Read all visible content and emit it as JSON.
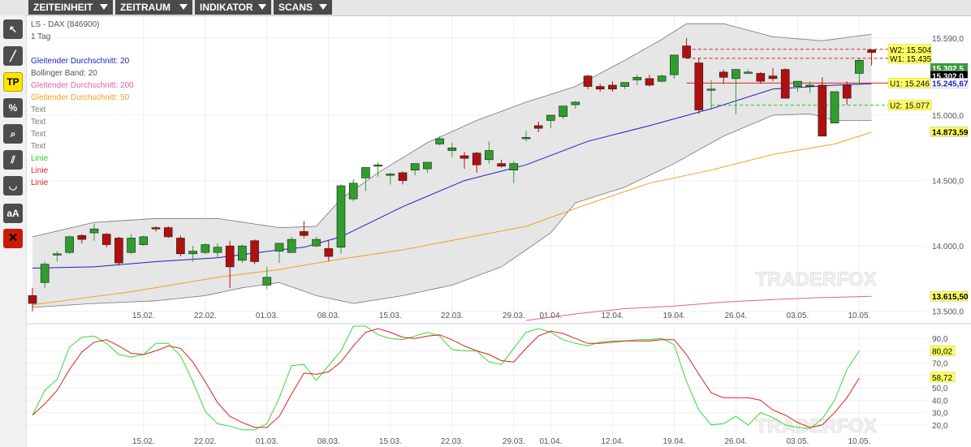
{
  "menu": [
    {
      "label": "ZEITEINHEIT"
    },
    {
      "label": "ZEITRAUM"
    },
    {
      "label": "INDIKATOR"
    },
    {
      "label": "SCANS"
    }
  ],
  "tools": [
    {
      "icon": "cursor-icon",
      "glyph": "↖"
    },
    {
      "icon": "line-draw-icon",
      "glyph": "╱"
    },
    {
      "label": "TP"
    },
    {
      "label": "%"
    },
    {
      "icon": "magnifier-icon",
      "glyph": "⌕"
    },
    {
      "icon": "parallel-lines-icon",
      "glyph": "⫽"
    },
    {
      "icon": "arc-icon",
      "glyph": "◡"
    },
    {
      "label": "aA"
    },
    {
      "icon": "delete-icon",
      "glyph": "✕"
    }
  ],
  "legend": {
    "instrument": "LS - DAX",
    "instrument_id": "(846900)",
    "timeframe": "1 Tag",
    "items": [
      {
        "label": "Gleitender Durchschnitt: 20",
        "color": "#2020c0"
      },
      {
        "label": "Bollinger Band: 20",
        "color": "#555555"
      },
      {
        "label": "Gleitender Durchschnitt: 200",
        "color": "#e060a0"
      },
      {
        "label": "Gleitender Durchschnitt: 50",
        "color": "#f0a020"
      },
      {
        "label": "Text",
        "color": "#777777"
      },
      {
        "label": "Text",
        "color": "#777777"
      },
      {
        "label": "Text",
        "color": "#777777"
      },
      {
        "label": "Text",
        "color": "#777777"
      },
      {
        "label": "Linie",
        "color": "#22cc22"
      },
      {
        "label": "Linie",
        "color": "#dd2222"
      },
      {
        "label": "Linie",
        "color": "#dd2222"
      }
    ]
  },
  "watermark": "TRADERFOX",
  "colors": {
    "up": "#2f9e2f",
    "down": "#b01010",
    "ma20": "#2020c0",
    "ma50": "#f0a020",
    "ma200": "#e060a0",
    "band": "#e2e2e2",
    "k": "#33dd33",
    "d": "#dd2222",
    "wave": "#22bb22"
  },
  "chart_data": [
    {
      "type": "candlestick",
      "title": "LS - DAX (846900)",
      "ylim": [
        13430,
        15720
      ],
      "y_ticks": [
        {
          "v": 15590,
          "label": "15.590,0"
        },
        {
          "v": 15000,
          "label": "15.000,0"
        },
        {
          "v": 14500,
          "label": "14.500,0"
        },
        {
          "v": 14000,
          "label": "14.000,0"
        },
        {
          "v": 13500,
          "label": "13.500,0"
        }
      ],
      "x_ticks": [
        {
          "i": 9,
          "label": "15.02."
        },
        {
          "i": 14,
          "label": "22.02."
        },
        {
          "i": 19,
          "label": "01.03."
        },
        {
          "i": 24,
          "label": "08.03."
        },
        {
          "i": 29,
          "label": "15.03."
        },
        {
          "i": 34,
          "label": "22.03."
        },
        {
          "i": 39,
          "label": "29.03."
        },
        {
          "i": 42,
          "label": "01.04."
        },
        {
          "i": 47,
          "label": "12.04."
        },
        {
          "i": 52,
          "label": "19.04."
        },
        {
          "i": 57,
          "label": "26.04."
        },
        {
          "i": 62,
          "label": "03.05."
        },
        {
          "i": 67,
          "label": "10.05."
        }
      ],
      "candles": [
        [
          13620,
          13680,
          13500,
          13560
        ],
        [
          13720,
          13880,
          13680,
          13860
        ],
        [
          13930,
          13960,
          13880,
          13940
        ],
        [
          13950,
          14080,
          13940,
          14070
        ],
        [
          14080,
          14090,
          14020,
          14050
        ],
        [
          14100,
          14170,
          14040,
          14130
        ],
        [
          14090,
          14100,
          13990,
          14010
        ],
        [
          14060,
          14070,
          13850,
          13870
        ],
        [
          13950,
          14090,
          13940,
          14060
        ],
        [
          14010,
          14080,
          14000,
          14070
        ],
        [
          14140,
          14150,
          14110,
          14130
        ],
        [
          14140,
          14150,
          14060,
          14070
        ],
        [
          14060,
          14080,
          13920,
          13940
        ],
        [
          13940,
          14000,
          13880,
          13960
        ],
        [
          13950,
          14020,
          13940,
          14010
        ],
        [
          13950,
          14020,
          13910,
          13990
        ],
        [
          14000,
          14040,
          13680,
          13840
        ],
        [
          13890,
          14010,
          13870,
          14000
        ],
        [
          14040,
          14050,
          13860,
          13880
        ],
        [
          13700,
          13840,
          13670,
          13760
        ],
        [
          13960,
          14000,
          13870,
          14020
        ],
        [
          13950,
          14070,
          13960,
          14050
        ],
        [
          14110,
          14190,
          14060,
          14080
        ],
        [
          14000,
          14070,
          13990,
          14050
        ],
        [
          13980,
          14040,
          13880,
          13920
        ],
        [
          13990,
          14470,
          13940,
          14460
        ],
        [
          14360,
          14510,
          14340,
          14480
        ],
        [
          14520,
          14560,
          14420,
          14600
        ],
        [
          14610,
          14640,
          14530,
          14620
        ],
        [
          14540,
          14560,
          14470,
          14550
        ],
        [
          14560,
          14570,
          14470,
          14500
        ],
        [
          14580,
          14600,
          14540,
          14630
        ],
        [
          14590,
          14630,
          14560,
          14640
        ],
        [
          14780,
          14840,
          14770,
          14820
        ],
        [
          14730,
          14790,
          14680,
          14750
        ],
        [
          14690,
          14720,
          14590,
          14670
        ],
        [
          14710,
          14720,
          14560,
          14620
        ],
        [
          14660,
          14800,
          14630,
          14730
        ],
        [
          14630,
          14660,
          14600,
          14610
        ],
        [
          14580,
          14650,
          14480,
          14630
        ],
        [
          14820,
          14880,
          14800,
          14830
        ],
        [
          14920,
          14950,
          14870,
          14900
        ],
        [
          14960,
          15000,
          14900,
          15000
        ],
        [
          14990,
          15000,
          14970,
          15070
        ],
        [
          15080,
          15110,
          15050,
          15100
        ],
        [
          15300,
          15310,
          15200,
          15220
        ],
        [
          15220,
          15240,
          15180,
          15200
        ],
        [
          15230,
          15260,
          15180,
          15200
        ],
        [
          15220,
          15250,
          15200,
          15250
        ],
        [
          15270,
          15310,
          15230,
          15290
        ],
        [
          15280,
          15310,
          15220,
          15230
        ],
        [
          15260,
          15310,
          15250,
          15300
        ],
        [
          15310,
          15390,
          15280,
          15460
        ],
        [
          15530,
          15590,
          15430,
          15440
        ],
        [
          15400,
          15440,
          15010,
          15040
        ],
        [
          15200,
          15270,
          15040,
          15200
        ],
        [
          15330,
          15350,
          15240,
          15290
        ],
        [
          15280,
          15330,
          15010,
          15350
        ],
        [
          15320,
          15350,
          15330,
          15330
        ],
        [
          15320,
          15330,
          15240,
          15260
        ],
        [
          15300,
          15360,
          15260,
          15280
        ],
        [
          15350,
          15360,
          15140,
          15130
        ],
        [
          15220,
          15250,
          15180,
          15260
        ],
        [
          15220,
          15260,
          15170,
          15230
        ],
        [
          15230,
          15290,
          14880,
          14840
        ],
        [
          14940,
          15170,
          14960,
          15180
        ],
        [
          15230,
          15260,
          15080,
          15130
        ],
        [
          15320,
          15440,
          15230,
          15420
        ],
        [
          15500,
          15490,
          15380,
          15480
        ]
      ],
      "series": [
        {
          "name": "Gleitender Durchschnitt: 20"
        },
        {
          "name": "Gleitender Durchschnitt: 50"
        },
        {
          "name": "Gleitender Durchschnitt: 200"
        },
        {
          "name": "Bollinger Band: 20"
        }
      ],
      "ma20": [
        [
          0,
          13830
        ],
        [
          5,
          13840
        ],
        [
          10,
          13880
        ],
        [
          15,
          13910
        ],
        [
          20,
          13970
        ],
        [
          22,
          13990
        ],
        [
          25,
          14070
        ],
        [
          30,
          14300
        ],
        [
          35,
          14500
        ],
        [
          40,
          14620
        ],
        [
          45,
          14800
        ],
        [
          50,
          14920
        ],
        [
          55,
          15050
        ],
        [
          60,
          15200
        ],
        [
          65,
          15230
        ],
        [
          68,
          15240
        ]
      ],
      "ma50": [
        [
          0,
          13550
        ],
        [
          8,
          13650
        ],
        [
          15,
          13760
        ],
        [
          20,
          13820
        ],
        [
          25,
          13900
        ],
        [
          30,
          13970
        ],
        [
          35,
          14060
        ],
        [
          40,
          14150
        ],
        [
          45,
          14320
        ],
        [
          50,
          14480
        ],
        [
          55,
          14580
        ],
        [
          60,
          14700
        ],
        [
          65,
          14780
        ],
        [
          68,
          14870
        ]
      ],
      "ma200": [
        [
          40,
          13430
        ],
        [
          44,
          13480
        ],
        [
          48,
          13520
        ],
        [
          52,
          13540
        ],
        [
          56,
          13570
        ],
        [
          60,
          13590
        ],
        [
          64,
          13605
        ],
        [
          68,
          13615
        ]
      ],
      "bb_upper": [
        [
          0,
          14070
        ],
        [
          5,
          14180
        ],
        [
          10,
          14210
        ],
        [
          15,
          14210
        ],
        [
          20,
          14140
        ],
        [
          23,
          14150
        ],
        [
          25,
          14360
        ],
        [
          28,
          14560
        ],
        [
          32,
          14790
        ],
        [
          36,
          14960
        ],
        [
          40,
          15100
        ],
        [
          44,
          15220
        ],
        [
          48,
          15420
        ],
        [
          51,
          15580
        ],
        [
          53,
          15700
        ],
        [
          56,
          15700
        ],
        [
          60,
          15600
        ],
        [
          64,
          15570
        ],
        [
          68,
          15620
        ]
      ],
      "bb_lower": [
        [
          0,
          13530
        ],
        [
          5,
          13560
        ],
        [
          10,
          13580
        ],
        [
          14,
          13620
        ],
        [
          17,
          13680
        ],
        [
          20,
          13720
        ],
        [
          23,
          13620
        ],
        [
          26,
          13560
        ],
        [
          30,
          13620
        ],
        [
          34,
          13700
        ],
        [
          38,
          13840
        ],
        [
          42,
          14100
        ],
        [
          44,
          14330
        ],
        [
          48,
          14450
        ],
        [
          52,
          14630
        ],
        [
          56,
          14840
        ],
        [
          60,
          15000
        ],
        [
          63,
          15010
        ],
        [
          65,
          14960
        ],
        [
          68,
          14960
        ]
      ],
      "levels": [
        {
          "label": "W2: 15.504",
          "v": 15504,
          "color": "#dd2222",
          "dash": true
        },
        {
          "label": "W1: 15.435",
          "v": 15435,
          "color": "#dd2222",
          "dash": true
        },
        {
          "label": "U1: 15.246",
          "v": 15246,
          "color": "#dd2222",
          "dash": false
        },
        {
          "label": "U2: 15.077",
          "v": 15077,
          "color": "#22cc22",
          "dash": true
        }
      ],
      "price_tags": [
        {
          "label": "15.302,5",
          "v": 15360,
          "bg": "#3a9a3a",
          "fg": "#ffffff"
        },
        {
          "label": "15.302,0",
          "v": 15302,
          "bg": "#000000",
          "fg": "#ffffff"
        },
        {
          "label": "15.245,67",
          "v": 15245.67,
          "bg": "#ffffff",
          "fg": "#2020c0"
        },
        {
          "label": "14.873,59",
          "v": 14873.59,
          "bg": "#ffff66",
          "fg": "#000000"
        },
        {
          "label": "13.615,50",
          "v": 13615.5,
          "bg": "#ffff66",
          "fg": "#000000"
        }
      ]
    },
    {
      "type": "line",
      "ylim": [
        12,
        100
      ],
      "y_ticks": [
        {
          "v": 90,
          "label": "90,0"
        },
        {
          "v": 80,
          "label": "80,0"
        },
        {
          "v": 70,
          "label": "70,0"
        },
        {
          "v": 60,
          "label": "60,0"
        },
        {
          "v": 50,
          "label": "50,0"
        },
        {
          "v": 40,
          "label": "40,0"
        },
        {
          "v": 30,
          "label": "30,0"
        },
        {
          "v": 20,
          "label": "20,0"
        }
      ],
      "k": [
        28,
        48,
        57,
        83,
        91,
        92,
        86,
        77,
        75,
        77,
        86,
        86,
        76,
        55,
        31,
        21,
        19,
        16,
        16,
        21,
        42,
        68,
        69,
        56,
        68,
        80,
        100,
        100,
        93,
        90,
        89,
        92,
        95,
        92,
        81,
        80,
        80,
        71,
        69,
        82,
        95,
        98,
        95,
        89,
        86,
        84,
        87,
        88,
        88,
        89,
        89,
        90,
        85,
        55,
        32,
        20,
        21,
        27,
        20,
        30,
        26,
        20,
        18,
        17,
        25,
        40,
        65,
        80
      ],
      "d": [
        28,
        37,
        48,
        65,
        79,
        87,
        89,
        84,
        78,
        77,
        80,
        84,
        82,
        71,
        55,
        38,
        27,
        22,
        18,
        18,
        27,
        45,
        62,
        61,
        63,
        71,
        84,
        95,
        98,
        95,
        91,
        90,
        92,
        93,
        89,
        84,
        80,
        77,
        72,
        71,
        82,
        92,
        96,
        94,
        90,
        86,
        86,
        87,
        88,
        88,
        88,
        89,
        89,
        77,
        61,
        46,
        42,
        42,
        42,
        40,
        32,
        28,
        22,
        18,
        20,
        30,
        42,
        58
      ],
      "k_tag": {
        "label": "80,02",
        "v": 80.02
      },
      "d_tag": {
        "label": "58,72",
        "v": 58.72
      }
    }
  ]
}
